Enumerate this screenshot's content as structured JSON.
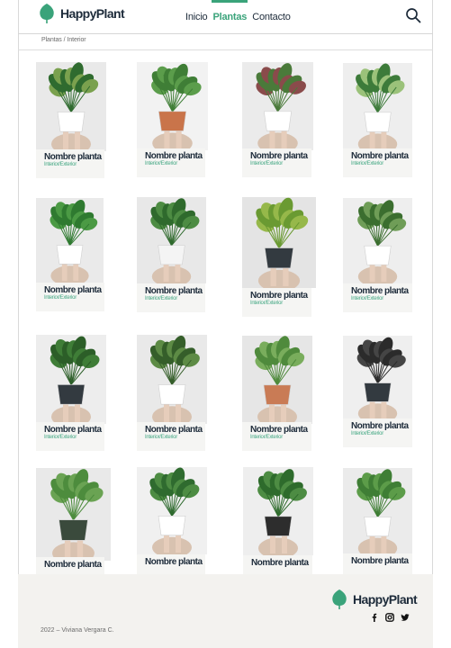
{
  "brand": {
    "name": "HappyPlant",
    "accent": "#3aa37a",
    "dark": "#1d2b3a"
  },
  "nav": {
    "items": [
      {
        "label": "Inicio",
        "active": false
      },
      {
        "label": "Plantas",
        "active": true
      },
      {
        "label": "Contacto",
        "active": false
      }
    ],
    "search_icon": "search-icon"
  },
  "breadcrumb": {
    "items": [
      "Plantas",
      "Interior"
    ],
    "separator": "/"
  },
  "cards": [
    {
      "name": "Nombre planta",
      "tag": "Interior/Exterior",
      "bg": "#e9e9e9"
    },
    {
      "name": "Nombre planta",
      "tag": "Interior/Exterior",
      "bg": "#f2f2f2"
    },
    {
      "name": "Nombre planta",
      "tag": "Interior/Exterior",
      "bg": "#ebebeb"
    },
    {
      "name": "Nombre planta",
      "tag": "Interior/Exterior",
      "bg": "#eeeeee"
    },
    {
      "name": "Nombre planta",
      "tag": "Interior/Exterior",
      "bg": "#eaeaea"
    },
    {
      "name": "Nombre planta",
      "tag": "Interior/Exterior",
      "bg": "#e8e8e8"
    },
    {
      "name": "Nombre planta",
      "tag": "Interior/Exterior",
      "bg": "#e4e4e4"
    },
    {
      "name": "Nombre planta",
      "tag": "Interior/Exterior",
      "bg": "#eeeeee"
    },
    {
      "name": "Nombre planta",
      "tag": "Interior/Exterior",
      "bg": "#ededed"
    },
    {
      "name": "Nombre planta",
      "tag": "Interior/Exterior",
      "bg": "#e9e9e9"
    },
    {
      "name": "Nombre planta",
      "tag": "Interior/Exterior",
      "bg": "#e6e6e6"
    },
    {
      "name": "Nombre planta",
      "tag": "Interior/Exterior",
      "bg": "#efefef"
    },
    {
      "name": "Nombre planta",
      "tag": "",
      "bg": "#e9e9e9"
    },
    {
      "name": "Nombre planta",
      "tag": "",
      "bg": "#f0f0f0"
    },
    {
      "name": "Nombre planta",
      "tag": "",
      "bg": "#eeeeee"
    },
    {
      "name": "Nombre planta",
      "tag": "",
      "bg": "#ebebeb"
    }
  ],
  "footer": {
    "brand": "HappyPlant",
    "social": [
      "facebook-icon",
      "instagram-icon",
      "twitter-icon"
    ],
    "copyright": "2022 – Viviana Vergara C."
  }
}
